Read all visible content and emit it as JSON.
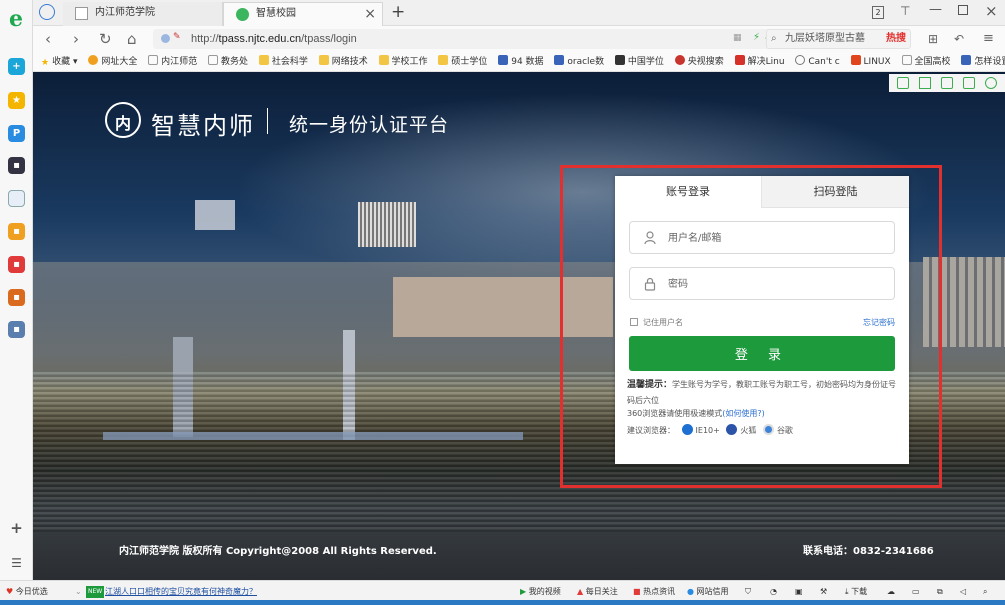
{
  "browser": {
    "tabs": [
      {
        "label": "内江师范学院"
      },
      {
        "label": "智慧校园"
      }
    ],
    "new_tab": "+",
    "tab_count": "2",
    "url_prefix": "http://",
    "url_host": "tpass.njtc.edu.cn",
    "url_path": "/tpass/login",
    "search_text": "九层妖塔原型古墓",
    "hot_label": "热搜",
    "bookmarks": [
      "收藏",
      "网址大全",
      "内江师范",
      "教务处",
      "社会科学",
      "网络技术",
      "学校工作",
      "硕士学位",
      "94 数据",
      "oracle数",
      "中国学位",
      "央视搜索",
      "解决Linu",
      "Can't c",
      "LINUX",
      "全国高校",
      "怎样设置"
    ]
  },
  "page": {
    "brand": "智慧内师",
    "platform": "统一身份认证平台",
    "seal_text": "内",
    "copyright": "内江师范学院 版权所有 Copyright@2008 All Rights Reserved.",
    "contact": "联系电话：0832-2341686"
  },
  "login": {
    "tab_account": "账号登录",
    "tab_qr": "扫码登陆",
    "username_placeholder": "用户名/邮箱",
    "password_placeholder": "密码",
    "remember_label": "记住用户名",
    "forgot_label": "忘记密码",
    "login_button": "登 录",
    "tip_title": "温馨提示：",
    "tip_text": "学生账号为学号，教职工账号为职工号，初始密码均为身份证号码后六位",
    "speed_text": "360浏览器请使用极速模式",
    "speed_link": "(如何使用?)",
    "suggest_label": "建议浏览器：",
    "browsers": [
      "IE10+",
      "火狐",
      "谷歌"
    ]
  },
  "statusbar": {
    "left_label": "今日优选",
    "news_badge": "NEW",
    "news_text": "江湖人口口相传的宝贝究竟有何神奇魔力？",
    "items": [
      "我的视频",
      "每日关注",
      "热点资讯",
      "网站信用",
      "下载"
    ]
  },
  "colors": {
    "accent_green": "#1d9a3c",
    "highlight_red": "#e1302e",
    "link_blue": "#2a6fd0"
  }
}
